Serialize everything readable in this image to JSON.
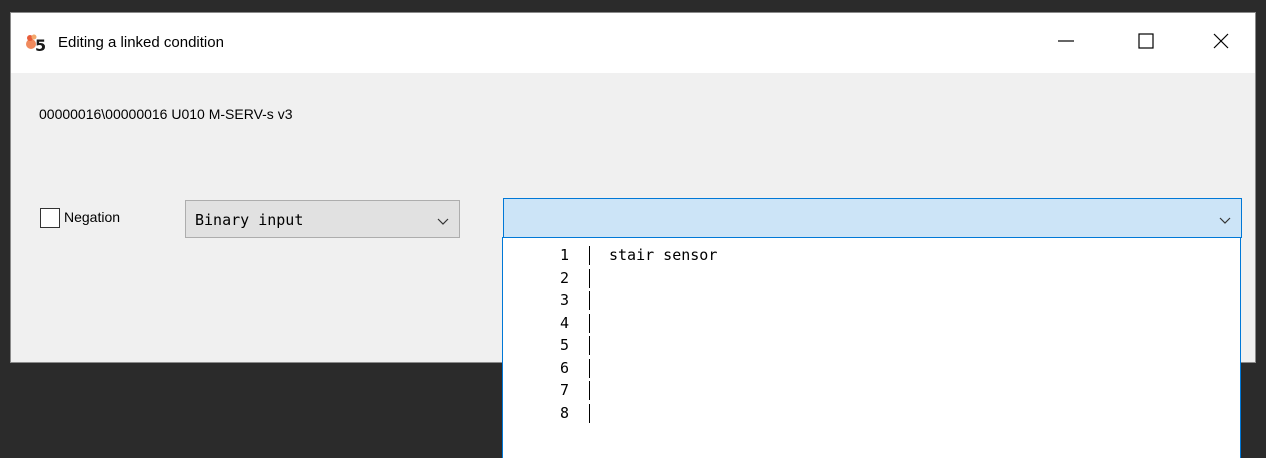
{
  "window": {
    "title": "Editing a linked condition"
  },
  "path": "00000016\\00000016 U010 M-SERV-s v3",
  "negation": {
    "label": "Negation",
    "checked": false
  },
  "type_select": {
    "value": "Binary input"
  },
  "item_select": {
    "value": ""
  },
  "dropdown": {
    "items": [
      {
        "num": "1",
        "text": "stair sensor"
      },
      {
        "num": "2",
        "text": ""
      },
      {
        "num": "3",
        "text": ""
      },
      {
        "num": "4",
        "text": ""
      },
      {
        "num": "5",
        "text": ""
      },
      {
        "num": "6",
        "text": ""
      },
      {
        "num": "7",
        "text": ""
      },
      {
        "num": "8",
        "text": ""
      }
    ]
  },
  "icons": {
    "app": "app-logo-5-icon",
    "minimize": "minimize-icon",
    "maximize": "maximize-icon",
    "close": "close-icon",
    "chevron": "chevron-down-icon"
  },
  "colors": {
    "titlebar": "#ffffff",
    "window_bg": "#f0f0f0",
    "focus_border": "#0078d7",
    "focus_fill": "#cce4f7",
    "desktop": "#2b2b2b"
  }
}
